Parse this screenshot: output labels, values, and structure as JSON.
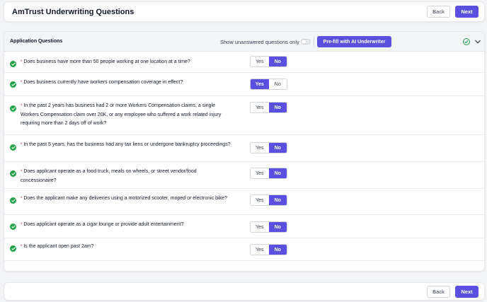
{
  "header": {
    "title": "AmTrust Underwriting Questions",
    "back_label": "Back",
    "next_label": "Next"
  },
  "panel": {
    "title": "Application Questions",
    "unanswered_label": "Show unanswered questions only",
    "unanswered_toggle": false,
    "prefill_label": "Pre-fill with AI Underwriter"
  },
  "questions": [
    {
      "required": "*",
      "text": "Does business have more than 50 people working at one location at a time?",
      "yes": "Yes",
      "no": "No",
      "answer": "No"
    },
    {
      "required": "*",
      "text": "Does business currently have workers compensation coverage in effect?",
      "yes": "Yes",
      "no": "No",
      "answer": "Yes"
    },
    {
      "required": "*",
      "text": "In the past 2 years has business had 2 or more Workers Compensation claims, a single Workers Compensation claim over 20K, or any employee who suffered a work related injury requiring more than 2 days off of work?",
      "yes": "Yes",
      "no": "No",
      "answer": "No"
    },
    {
      "required": "*",
      "text": "In the past 5 years, has the business had any tax liens or undergone bankruptcy proceedings?",
      "yes": "Yes",
      "no": "No",
      "answer": "No"
    },
    {
      "required": "*",
      "text": "Does applicant operate as a food truck, meals on wheels, or street vendor/food concessionaire?",
      "yes": "Yes",
      "no": "No",
      "answer": "No"
    },
    {
      "required": "*",
      "text": "Does the applicant make any deliveries using a motorized scooter, moped or electronic bike?",
      "yes": "Yes",
      "no": "No",
      "answer": "No"
    },
    {
      "required": "*",
      "text": "Does applicant operate as a cigar lounge or provide adult entertainment?",
      "yes": "Yes",
      "no": "No",
      "answer": "No"
    },
    {
      "required": "*",
      "text": "Is the applicant open past 2am?",
      "yes": "Yes",
      "no": "No",
      "answer": "No"
    }
  ],
  "footer": {
    "back_label": "Back",
    "next_label": "Next"
  },
  "colors": {
    "accent": "#5b4fe0",
    "success": "#22a34a",
    "required": "#dc2626"
  },
  "icons": {
    "answered": "check-circle-icon",
    "section_complete": "check-circle-outline-icon",
    "collapse": "chevron-down-icon"
  }
}
